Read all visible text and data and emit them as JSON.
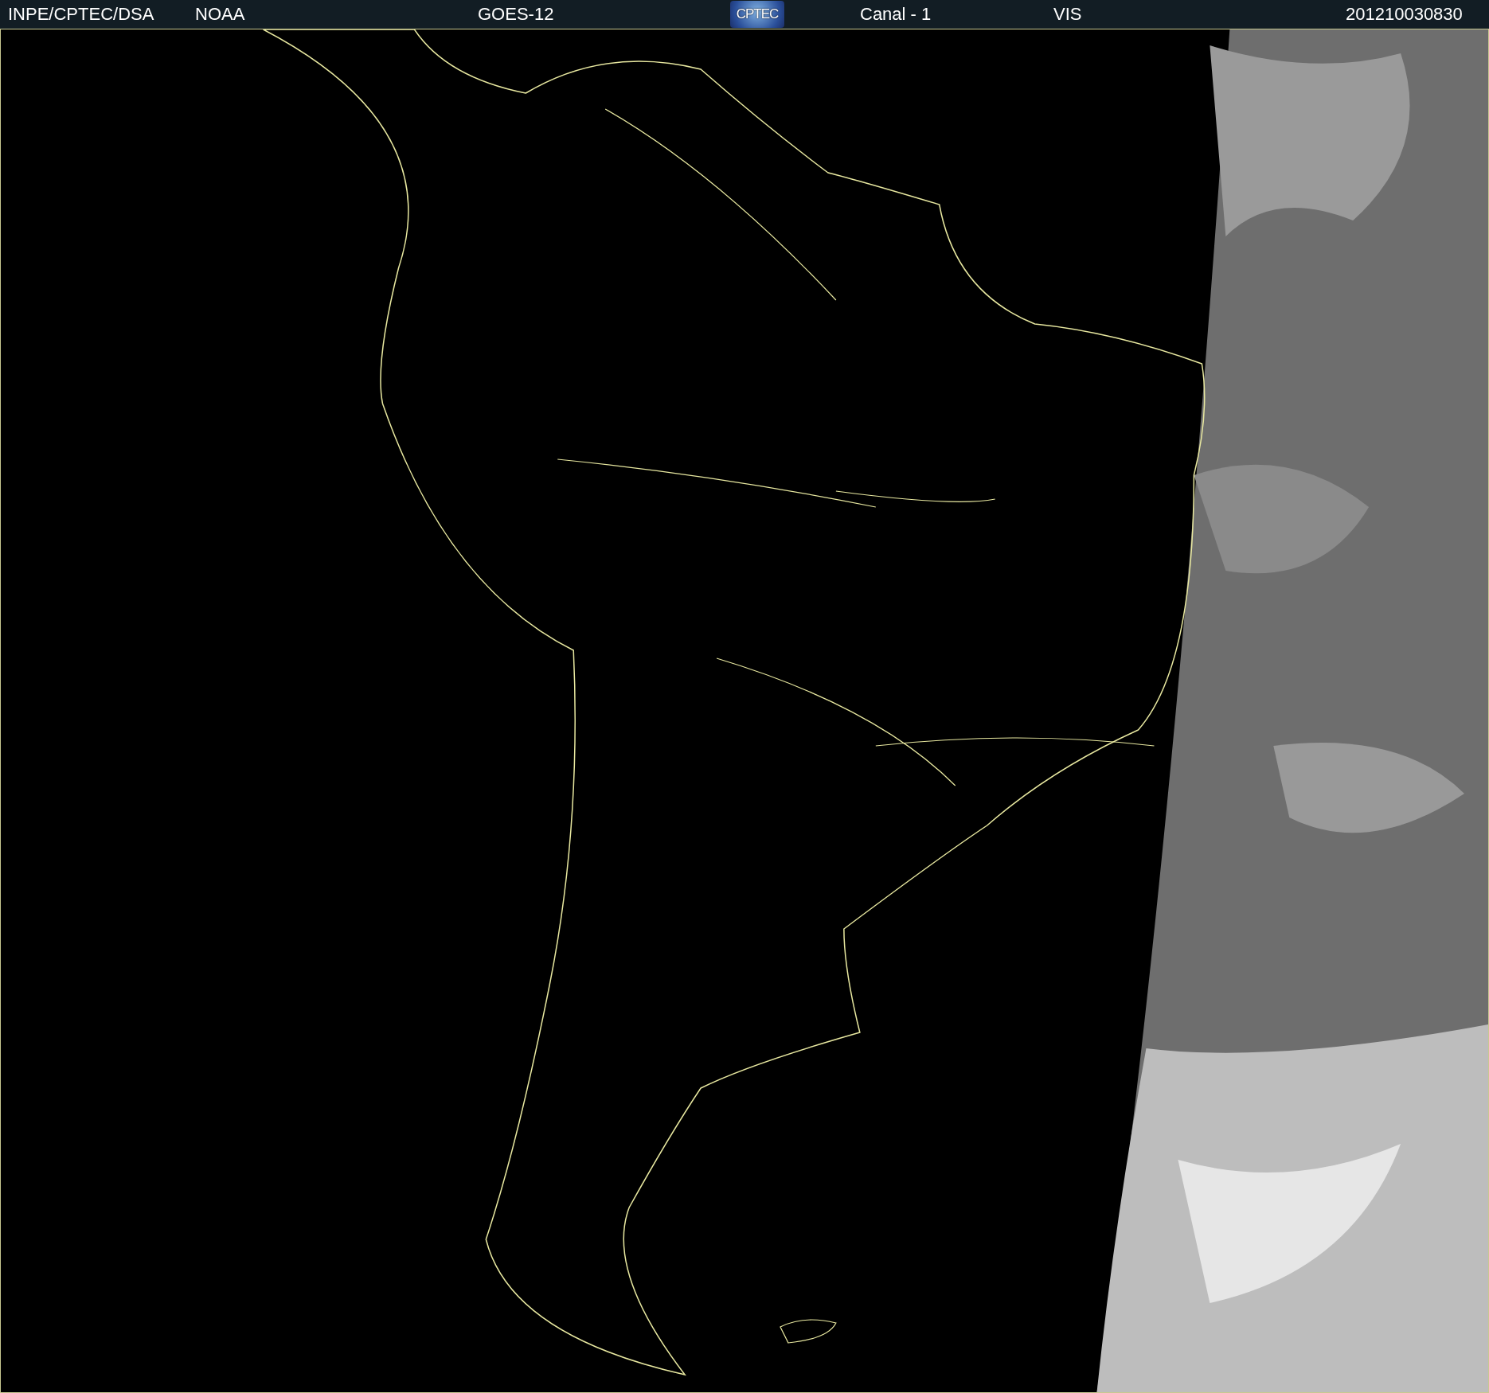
{
  "header": {
    "items": [
      {
        "kind": "text",
        "text": "INPE/CPTEC/DSA"
      },
      {
        "kind": "text",
        "text": "NOAA"
      },
      {
        "kind": "text",
        "text": "GOES-12"
      },
      {
        "kind": "logo",
        "text": "CPTEC"
      },
      {
        "kind": "text",
        "text": "Canal - 1"
      },
      {
        "kind": "text",
        "text": "VIS"
      },
      {
        "kind": "text",
        "text": "201210030830"
      }
    ]
  }
}
